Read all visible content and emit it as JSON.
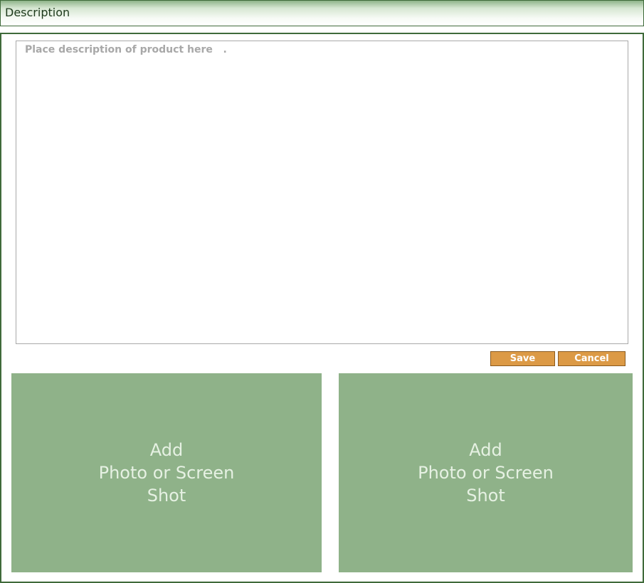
{
  "header": {
    "title": "Description"
  },
  "description": {
    "placeholder": "Place description of product here   .",
    "value": ""
  },
  "actions": {
    "save_label": "Save",
    "cancel_label": "Cancel"
  },
  "photos": [
    {
      "label": "Add\nPhoto or Screen\nShot"
    },
    {
      "label": "Add\nPhoto or Screen\nShot"
    }
  ],
  "colors": {
    "accent_green": "#3f6a3a",
    "tile_green": "#8fb289",
    "button_orange": "#dc9a46"
  }
}
